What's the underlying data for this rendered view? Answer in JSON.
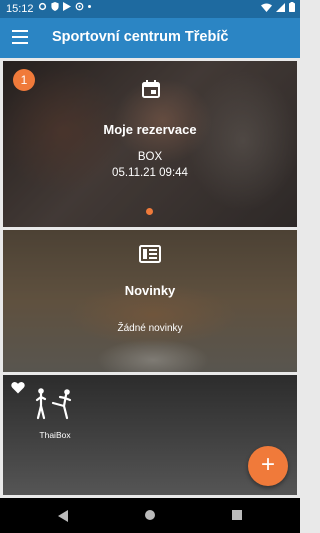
{
  "status": {
    "time": "15:12"
  },
  "appbar": {
    "title": "Sportovní centrum Třebíč"
  },
  "reservations": {
    "badge_count": "1",
    "title": "Moje rezervace",
    "item_name": "BOX",
    "item_datetime": "05.11.21 09:44"
  },
  "news": {
    "title": "Novinky",
    "empty_text": "Žádné novinky"
  },
  "favorites": {
    "items": [
      {
        "label": "ThaiBox"
      }
    ]
  },
  "fab": {
    "label": "+"
  },
  "colors": {
    "primary": "#2b85c4",
    "status_bar": "#1e6aa0",
    "accent": "#f07a3a"
  },
  "icons": [
    "menu-icon",
    "calendar-icon",
    "newspaper-icon",
    "heart-icon",
    "thaibox-icon",
    "plus-icon"
  ]
}
